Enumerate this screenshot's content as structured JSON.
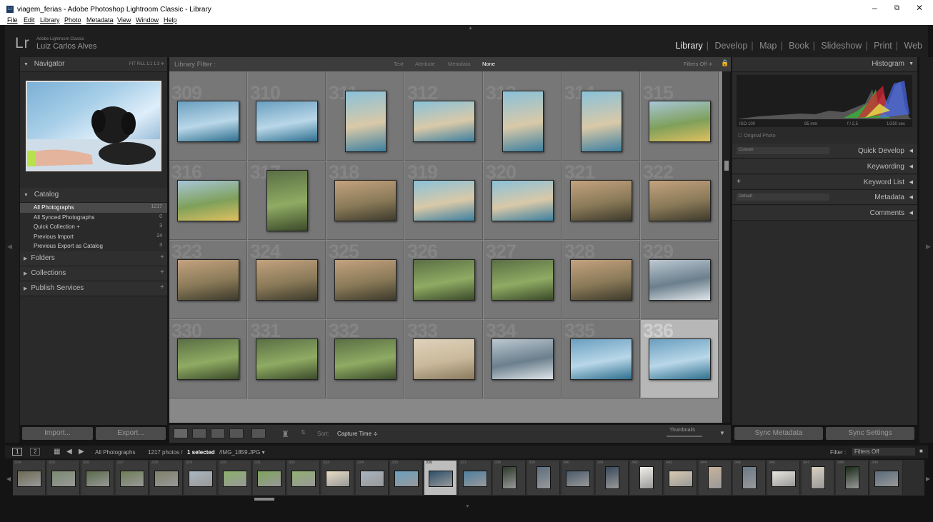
{
  "window": {
    "title": "viagem_ferias - Adobe Photoshop Lightroom Classic - Library",
    "icon": "Lr"
  },
  "menu": [
    "File",
    "Edit",
    "Library",
    "Photo",
    "Metadata",
    "View",
    "Window",
    "Help"
  ],
  "identity": {
    "logo": "Lr",
    "product": "Adobe Lightroom Classic",
    "user": "Luiz Carlos Alves"
  },
  "modules": [
    "Library",
    "Develop",
    "Map",
    "Book",
    "Slideshow",
    "Print",
    "Web"
  ],
  "active_module": "Library",
  "navigator": {
    "title": "Navigator",
    "zoom_options": "FIT  FILL  1:1  1:3 ≑"
  },
  "catalog": {
    "title": "Catalog",
    "items": [
      {
        "label": "All Photographs",
        "count": "1217"
      },
      {
        "label": "All Synced Photographs",
        "count": "0"
      },
      {
        "label": "Quick Collection +",
        "count": "3"
      },
      {
        "label": "Previous Import",
        "count": "24"
      },
      {
        "label": "Previous Export as Catalog",
        "count": "3"
      }
    ]
  },
  "left_sections": [
    "Folders",
    "Collections",
    "Publish Services"
  ],
  "left_buttons": {
    "import": "Import...",
    "export": "Export..."
  },
  "filterbar": {
    "title": "Library Filter :",
    "tabs": [
      "Text",
      "Attribute",
      "Metadata",
      "None"
    ],
    "active": "None",
    "filters": "Filters Off ≑"
  },
  "grid_rows": [
    [
      "309",
      "310",
      "311",
      "312",
      "313",
      "314",
      "315"
    ],
    [
      "316",
      "317",
      "318",
      "319",
      "320",
      "321",
      "322"
    ],
    [
      "323",
      "324",
      "325",
      "326",
      "327",
      "328",
      "329"
    ],
    [
      "330",
      "331",
      "332",
      "333",
      "334",
      "335",
      "336"
    ]
  ],
  "selected_cell": "336",
  "toolbar": {
    "sort_label": "Sort:",
    "sort_value": "Capture Time ≑",
    "thumbnails": "Thumbnails"
  },
  "histogram": {
    "title": "Histogram",
    "iso": "ISO 100",
    "focal": "85 mm",
    "aperture": "f / 2,5",
    "shutter": "1/250 sec",
    "original": "Original Photo"
  },
  "right_panels": [
    {
      "label": "Quick Develop",
      "select": "Custom"
    },
    {
      "label": "Keywording",
      "select": ""
    },
    {
      "label": "Keyword List",
      "select": "+"
    },
    {
      "label": "Metadata",
      "select": "Default"
    },
    {
      "label": "Comments",
      "select": ""
    }
  ],
  "right_buttons": {
    "sync_metadata": "Sync Metadata",
    "sync_settings": "Sync Settings"
  },
  "filmstrip_header": {
    "source": "All Photographs",
    "count": "1217 photos /",
    "selected": "1 selected",
    "file": "/IMG_1859.JPG ▾",
    "filter_label": "Filter :",
    "filter_value": "Filters Off"
  },
  "filmstrip": [
    "324",
    "325",
    "326",
    "327",
    "328",
    "329",
    "330",
    "331",
    "332",
    "333",
    "334",
    "335",
    "336",
    "337",
    "338",
    "339",
    "340",
    "341",
    "342",
    "343",
    "344",
    "345",
    "346",
    "347",
    "348",
    "349"
  ],
  "filmstrip_selected": "336",
  "colors": {
    "accent": "#ffffff",
    "panel": "#2a2a2a",
    "grid": "#888888",
    "selected": "#bdbdbd"
  }
}
